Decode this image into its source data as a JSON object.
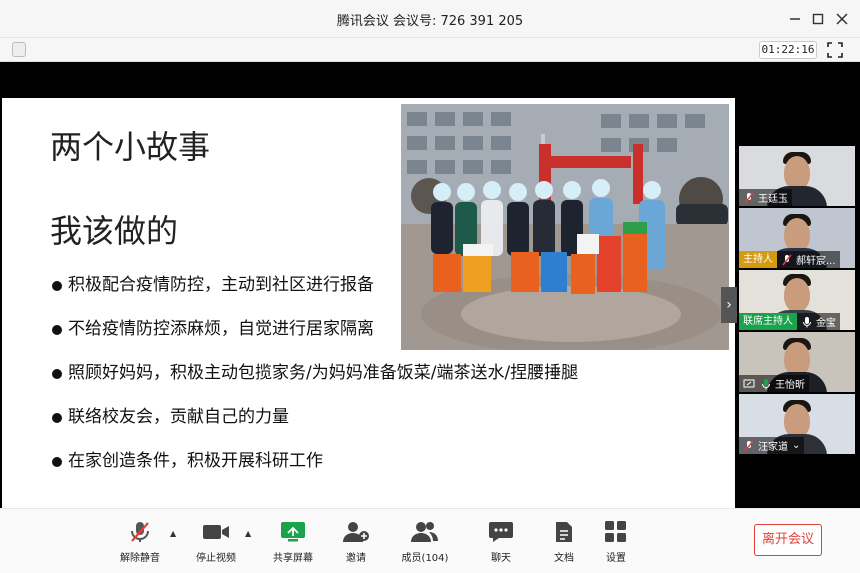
{
  "window": {
    "title": "腾讯会议 会议号: 726 391 205",
    "minimize_icon": "minimize-icon",
    "maximize_icon": "maximize-icon",
    "close_icon": "close-icon"
  },
  "security_bar": {
    "timer": "01:22:16"
  },
  "slide": {
    "title": "两个小故事",
    "subtitle": "我该做的",
    "bullets": [
      "积极配合疫情防控，主动到社区进行报备",
      "不给疫情防控添麻烦，自觉进行居家隔离",
      "照顾好妈妈，积极主动包揽家务/为妈妈准备饭菜/端茶送水/捏腰捶腿",
      "联络校友会，贡献自己的力量",
      "在家创造条件，积极开展科研工作"
    ],
    "next_icon": "chevron-right-icon"
  },
  "participants": [
    {
      "name": "王廷玉",
      "tag": "",
      "mic": "muted"
    },
    {
      "name": "郝轩宸...",
      "tag": "主持人",
      "mic": "muted"
    },
    {
      "name": "金宝",
      "tag": "联席主持人",
      "mic": "on"
    },
    {
      "name": "王怡昕",
      "tag": "",
      "mic": "on"
    },
    {
      "name": "汪家道",
      "tag": "",
      "mic": "muted"
    }
  ],
  "toolbar": {
    "unmute": "解除静音",
    "stop_video": "停止视频",
    "share_screen": "共享屏幕",
    "invite": "邀请",
    "members": "成员(104)",
    "chat": "聊天",
    "docs": "文档",
    "settings": "设置",
    "leave": "离开会议"
  },
  "colors": {
    "accent_green": "#1aa34a",
    "host_tag": "#d49a10",
    "leave_red": "#e0413a"
  }
}
